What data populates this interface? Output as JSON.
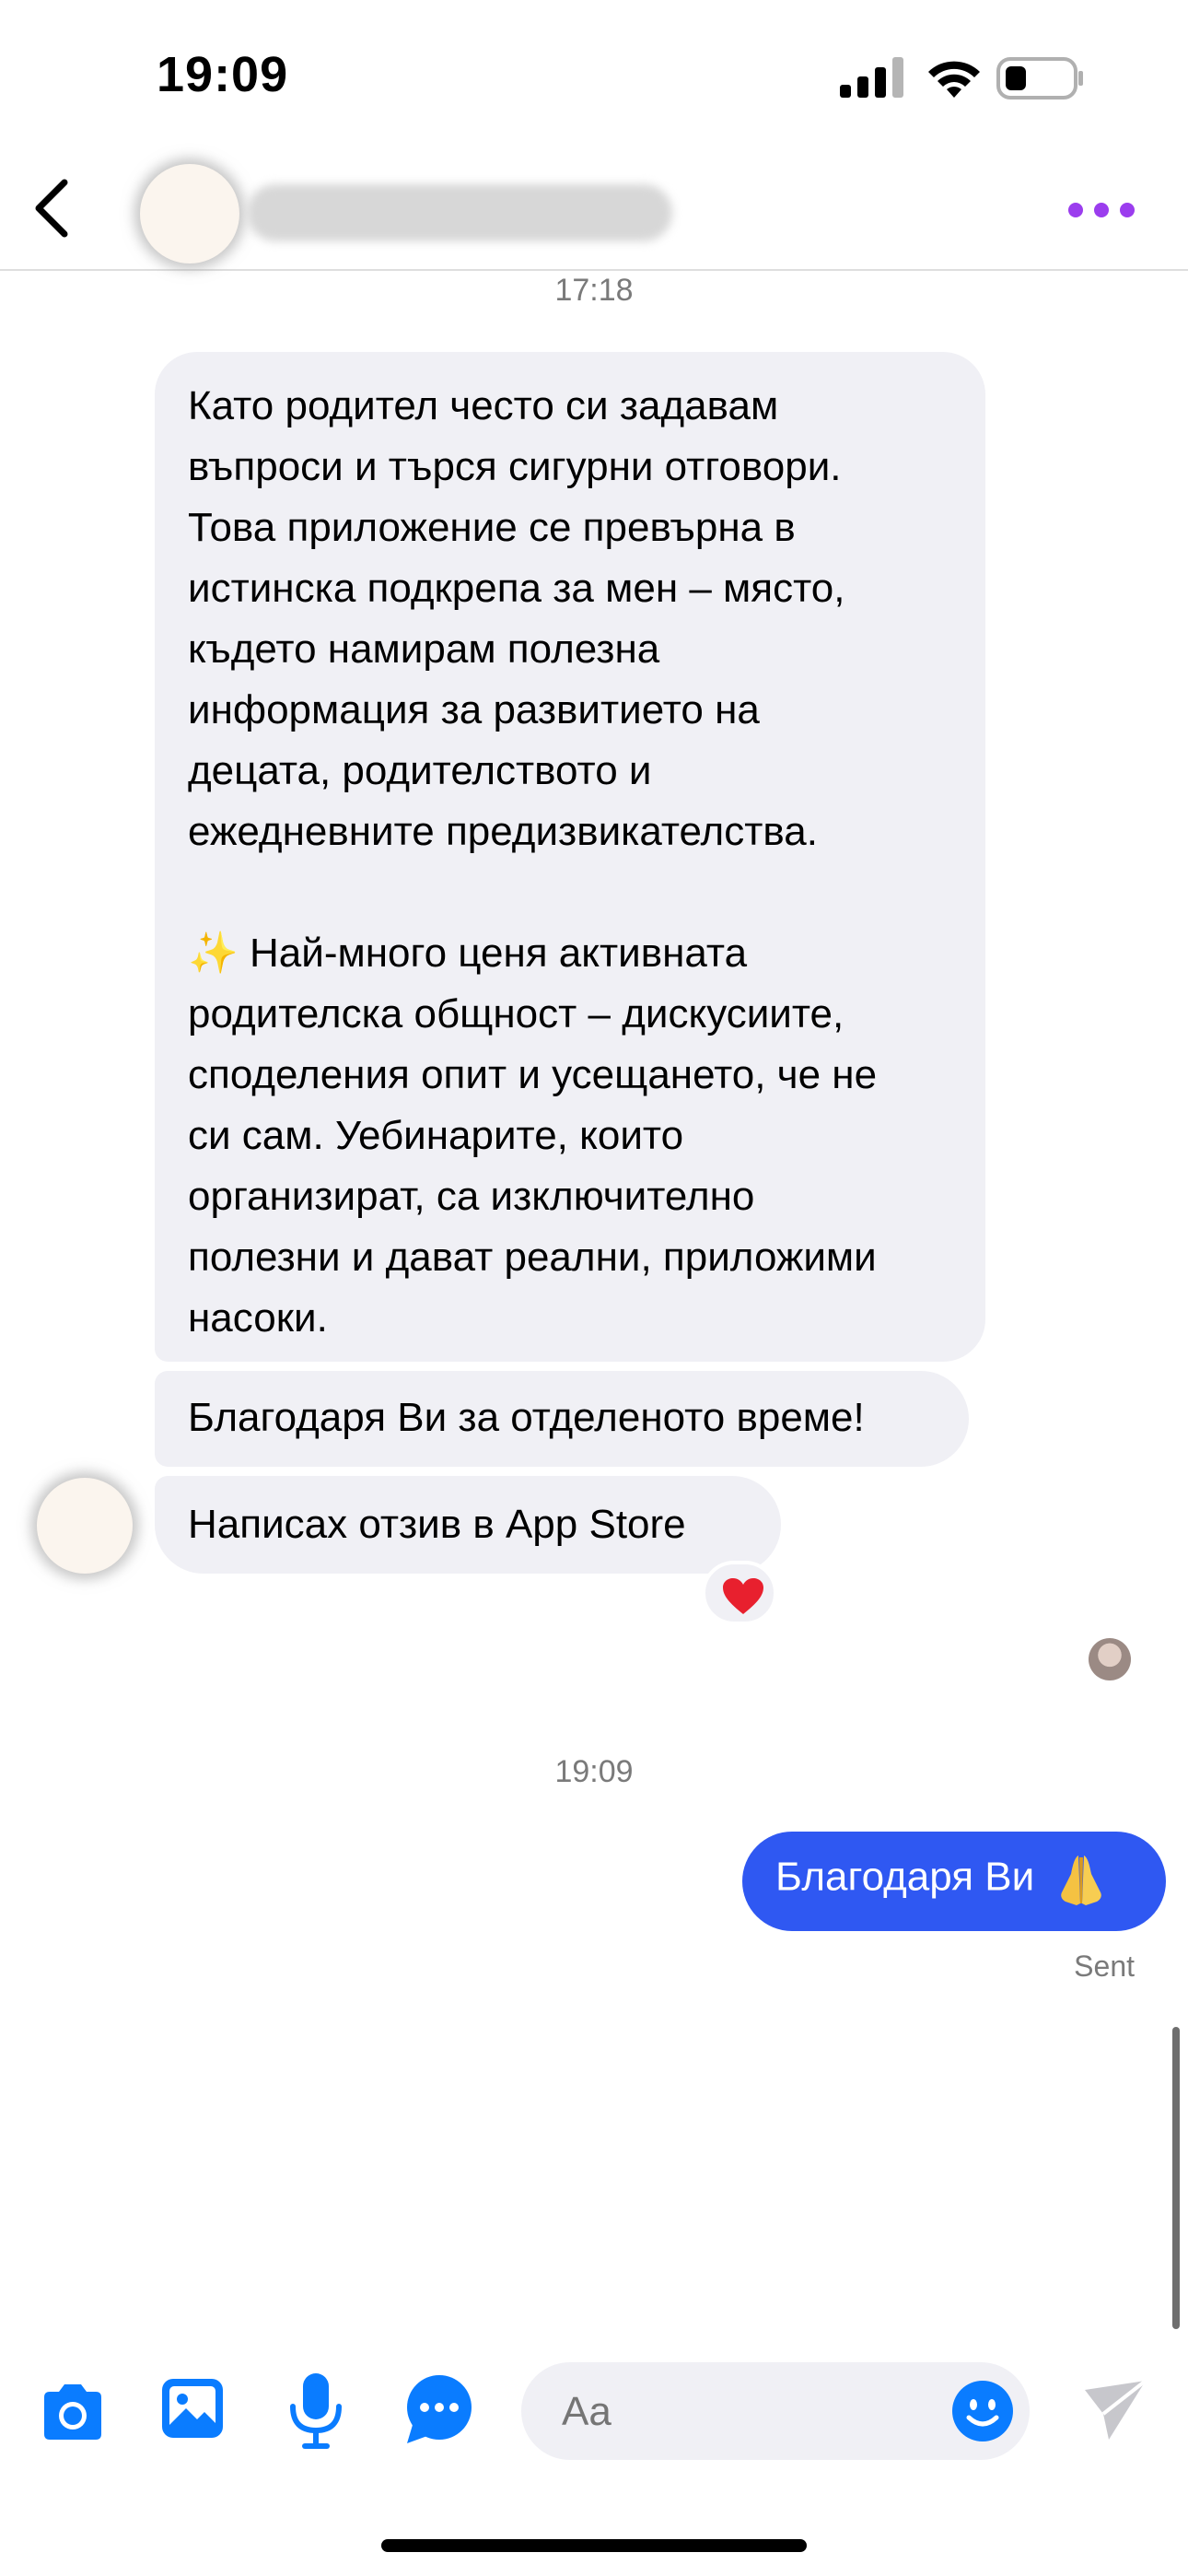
{
  "status_bar": {
    "time": "19:09"
  },
  "header": {
    "contact_name": ""
  },
  "messages": {
    "timestamp_1": "17:18",
    "incoming": [
      "Като родител често си задавам\nвъпроси и търся сигурни отговори.\nТова приложение се превърна в\nистинска подкрепа за мен – място,\nкъдето намирам полезна\nинформация за развитието на\nдецата, родителството и\nежедневните предизвикателства.\n\n✨ Най-много ценя активната\nродителска общност – дискусиите,\nсподеления опит и усещането, че не\nси сам. Уебинарите, които\nорганизират, са изключително\nполезни и дават реални, приложими\nнасоки.",
      "Благодаря Ви за отделеното време!",
      "Написах отзив в App Store"
    ],
    "reaction": "heart",
    "timestamp_2": "19:09",
    "outgoing": "Благодаря Ви",
    "sent_label": "Sent"
  },
  "composer": {
    "placeholder": "Aa"
  },
  "icons": {
    "back": "chevron-left-icon",
    "more": "more-dots-icon",
    "camera": "camera-icon",
    "photo": "photo-icon",
    "mic": "microphone-icon",
    "chat": "chat-bubble-icon",
    "emoji": "emoji-icon",
    "send": "send-icon",
    "pray": "folded-hands-emoji",
    "sparkles": "sparkles-emoji"
  },
  "colors": {
    "accent": "#0a7cff",
    "outgoing_bubble": "#2f58f2",
    "incoming_bubble": "#f0f0f5",
    "more_dots": "#9b3dee"
  }
}
